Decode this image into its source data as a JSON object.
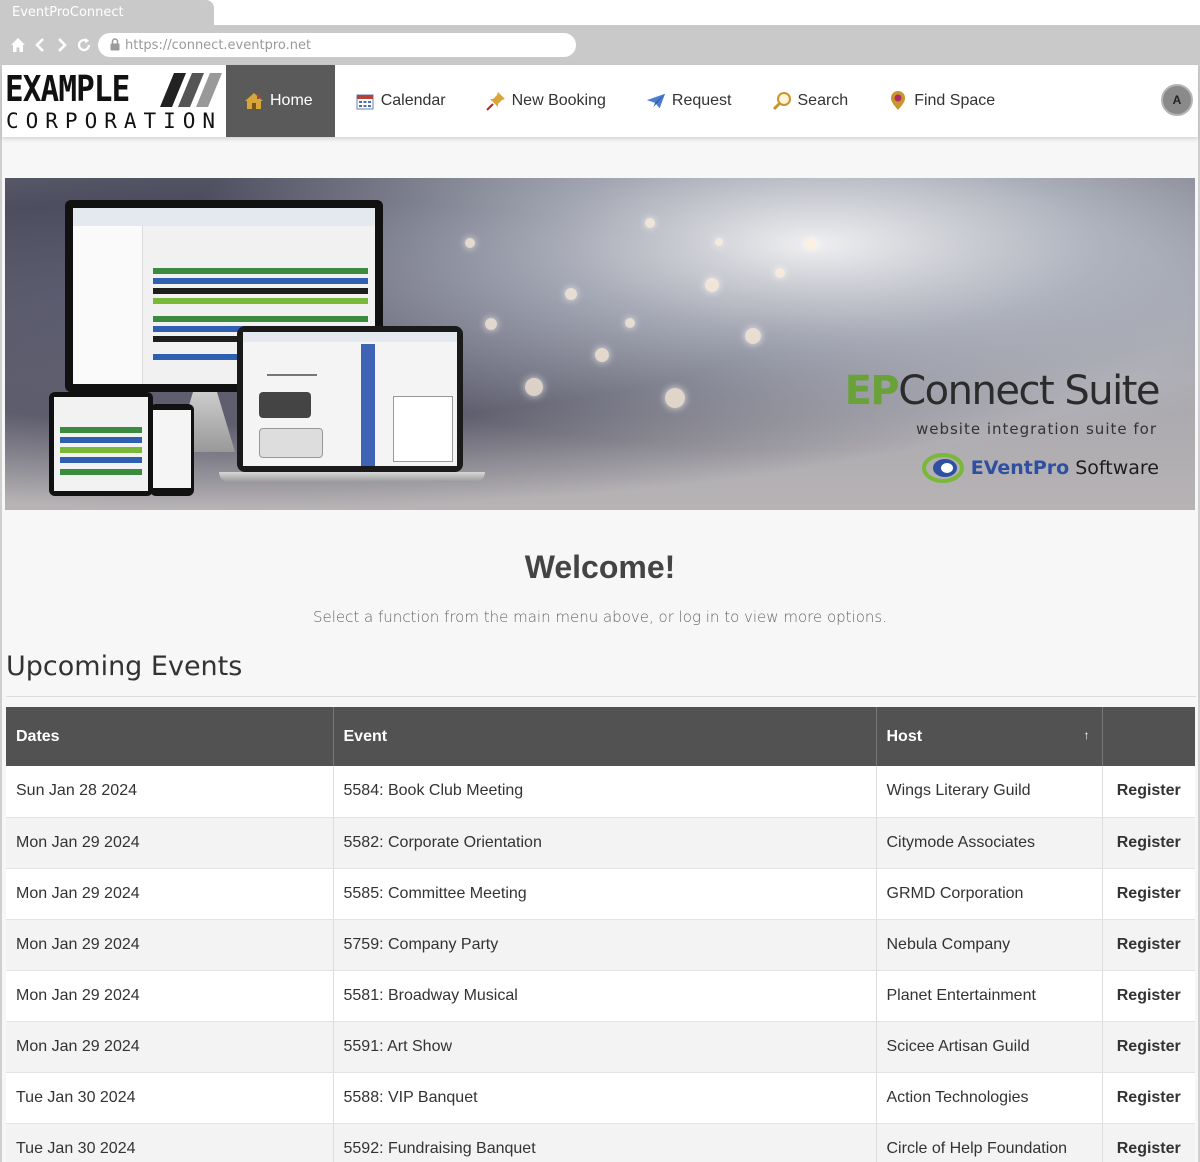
{
  "browser": {
    "tab_title": "EventProConnect",
    "url": "https://connect.eventpro.net"
  },
  "header": {
    "logo_top": "EXAMPLE",
    "logo_bottom": "CORPORATION",
    "menu": [
      {
        "label": "Home",
        "icon": "house-icon",
        "active": true
      },
      {
        "label": "Calendar",
        "icon": "calendar-icon"
      },
      {
        "label": "New Booking",
        "icon": "pushpin-icon"
      },
      {
        "label": "Request",
        "icon": "paper-plane-icon"
      },
      {
        "label": "Search",
        "icon": "magnifier-icon"
      },
      {
        "label": "Find Space",
        "icon": "map-pin-icon"
      }
    ],
    "avatar_initial": "A"
  },
  "banner": {
    "brand_ep": "EP",
    "brand_title": "Connect Suite",
    "brand_subtitle": "website integration suite for",
    "brand_logo_ev": "EVentPro",
    "brand_logo_rest": "Software"
  },
  "welcome": {
    "title": "Welcome!",
    "subtitle": "Select a function from the main menu above, or log in to view more options."
  },
  "events": {
    "section_title": "Upcoming Events",
    "columns": [
      "Dates",
      "Event",
      "Host",
      ""
    ],
    "sort_indicator": "↑",
    "rows": [
      {
        "date": "Sun Jan 28 2024",
        "event": "5584: Book Club Meeting",
        "host": "Wings Literary Guild",
        "action": "Register"
      },
      {
        "date": "Mon Jan 29 2024",
        "event": "5582: Corporate Orientation",
        "host": "Citymode Associates",
        "action": "Register"
      },
      {
        "date": "Mon Jan 29 2024",
        "event": "5585: Committee Meeting",
        "host": "GRMD Corporation",
        "action": "Register"
      },
      {
        "date": "Mon Jan 29 2024",
        "event": "5759: Company Party",
        "host": "Nebula Company",
        "action": "Register"
      },
      {
        "date": "Mon Jan 29 2024",
        "event": "5581: Broadway Musical",
        "host": "Planet Entertainment",
        "action": "Register"
      },
      {
        "date": "Mon Jan 29 2024",
        "event": "5591: Art Show",
        "host": "Scicee Artisan Guild",
        "action": "Register"
      },
      {
        "date": "Tue Jan 30 2024",
        "event": "5588: VIP Banquet",
        "host": "Action Technologies",
        "action": "Register"
      },
      {
        "date": "Tue Jan 30 2024",
        "event": "5592: Fundraising Banquet",
        "host": "Circle of Help Foundation",
        "action": "Register"
      }
    ]
  },
  "colors": {
    "active_menu_bg": "#5a5a5a",
    "table_header_bg": "#525252",
    "chrome_gray": "#c9c9c9"
  }
}
